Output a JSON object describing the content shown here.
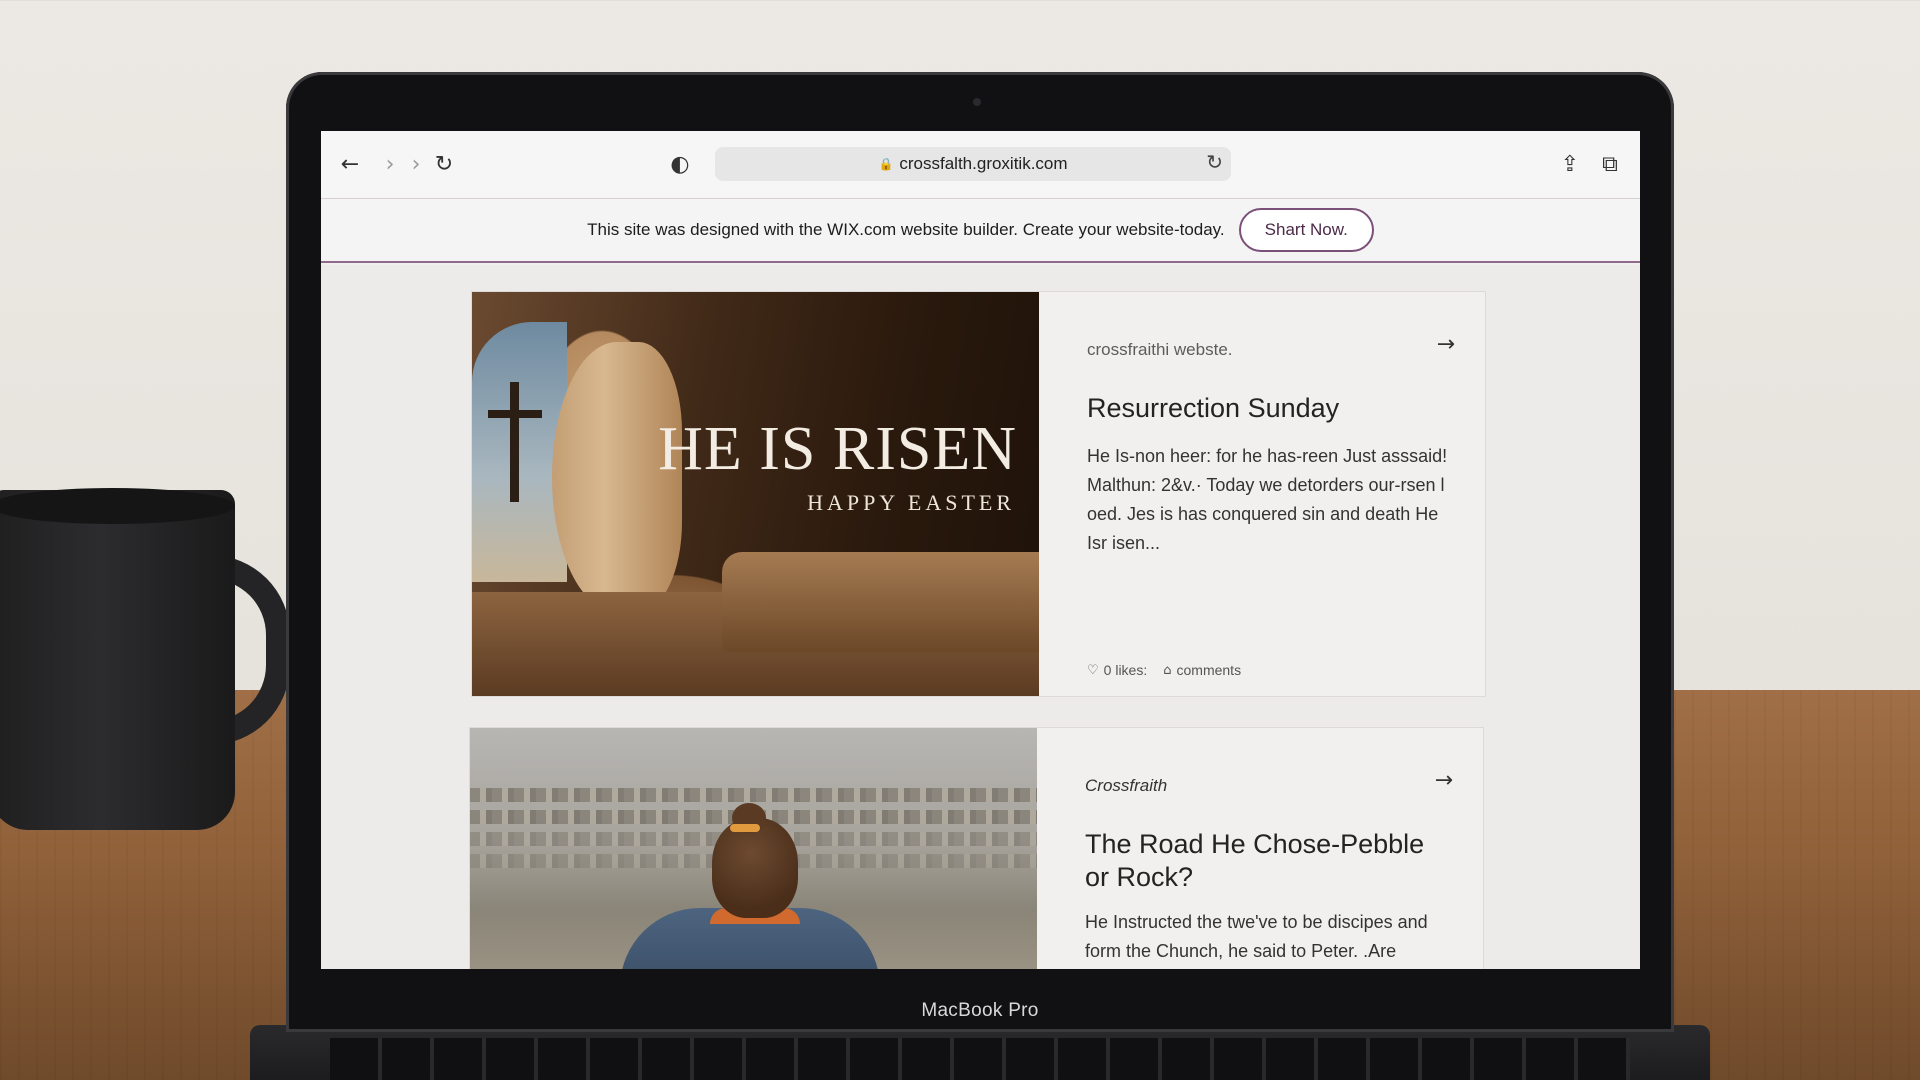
{
  "browser": {
    "url": "crossfalth.groxitik.com"
  },
  "wix_banner": {
    "text": "This site was designed with the WIX.com website builder. Create your website-today.",
    "button_label": "Shart Now."
  },
  "posts": [
    {
      "image_title": "HE IS RISEN",
      "image_subtitle": "HAPPY EASTER",
      "source": "crossfraithi webste.",
      "title": "Resurrection Sunday",
      "excerpt": "He Is-non heer: for he has-reen Just asssaid! Malthun: 2&v.· Today we detorders our-rsen l oed. Jes is has conquered sin and death He Isr isen...",
      "likes": "0 likes:",
      "comments": "comments"
    },
    {
      "source": "Crossfraith",
      "title": "The Road He Chose-Pebble or Rock?",
      "excerpt": "He Instructed the twe've to be discipes and form the Chunch, he said to Peter. .Are"
    }
  ],
  "device": {
    "label": "MacBook Pro"
  }
}
